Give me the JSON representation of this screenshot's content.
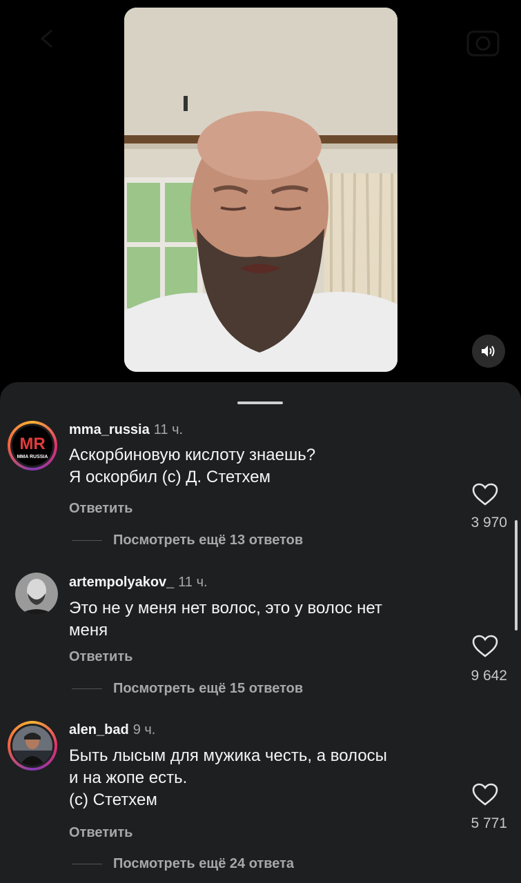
{
  "video": {
    "sound_icon": "speaker-icon"
  },
  "comments": [
    {
      "username": "mma_russia",
      "time": "11 ч.",
      "lines": [
        "Аскорбиновую кислоту знаешь?",
        "Я оскорбил (с) Д. Стетхем"
      ],
      "likes": "3 970",
      "reply": "Ответить",
      "more": "Посмотреть ещё 13 ответов",
      "avatar_text": "MMA RUSSIA"
    },
    {
      "username": "artempolyakov_",
      "time": "11 ч.",
      "lines": [
        "Это не у меня нет волос, это у волос нет",
        "меня"
      ],
      "likes": "9 642",
      "reply": "Ответить",
      "more": "Посмотреть ещё 15 ответов"
    },
    {
      "username": "alen_bad",
      "time": "9 ч.",
      "lines": [
        "Быть лысым для мужика честь, а волосы",
        "и на жопе есть.",
        "(с) Стетхем"
      ],
      "likes": "5 771",
      "reply": "Ответить",
      "more": "Посмотреть ещё 24 ответа"
    }
  ],
  "colors": {
    "sheet": "#1e1f21",
    "accent_ring": "#e1306c",
    "secondary_text": "#a8a8a8"
  }
}
